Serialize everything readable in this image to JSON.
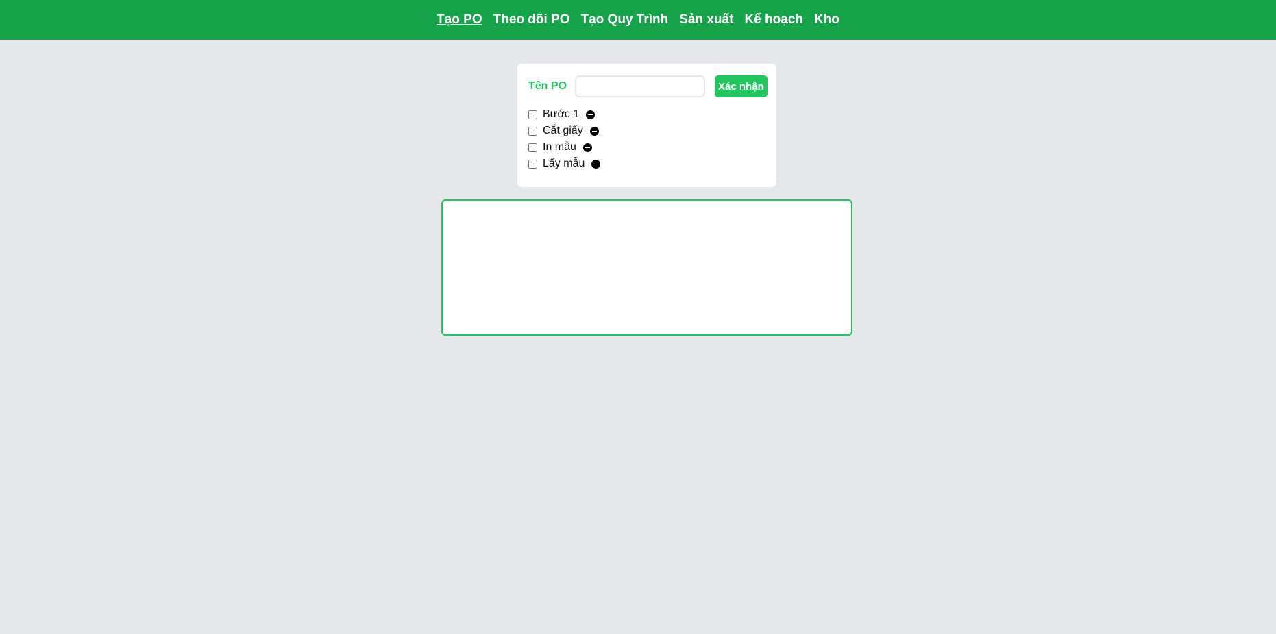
{
  "nav": {
    "items": [
      {
        "label": "Tạo PO",
        "active": true
      },
      {
        "label": "Theo dõi PO",
        "active": false
      },
      {
        "label": "Tạo Quy Trình",
        "active": false
      },
      {
        "label": "Sản xuất",
        "active": false
      },
      {
        "label": "Kế hoạch",
        "active": false
      },
      {
        "label": "Kho",
        "active": false
      }
    ]
  },
  "form": {
    "po_label": "Tên PO",
    "po_value": "",
    "po_placeholder": "",
    "confirm_label": "Xác nhận"
  },
  "steps": [
    {
      "label": "Bước 1",
      "checked": false
    },
    {
      "label": "Cắt giấy",
      "checked": false
    },
    {
      "label": "In mẫu",
      "checked": false
    },
    {
      "label": "Lấy mẫu",
      "checked": false
    }
  ],
  "output": {
    "content": ""
  },
  "colors": {
    "nav_bg": "#16a34a",
    "accent": "#22c55e",
    "page_bg": "#e5e7eb"
  },
  "icons": {
    "remove_step": "minus-circle-icon"
  }
}
